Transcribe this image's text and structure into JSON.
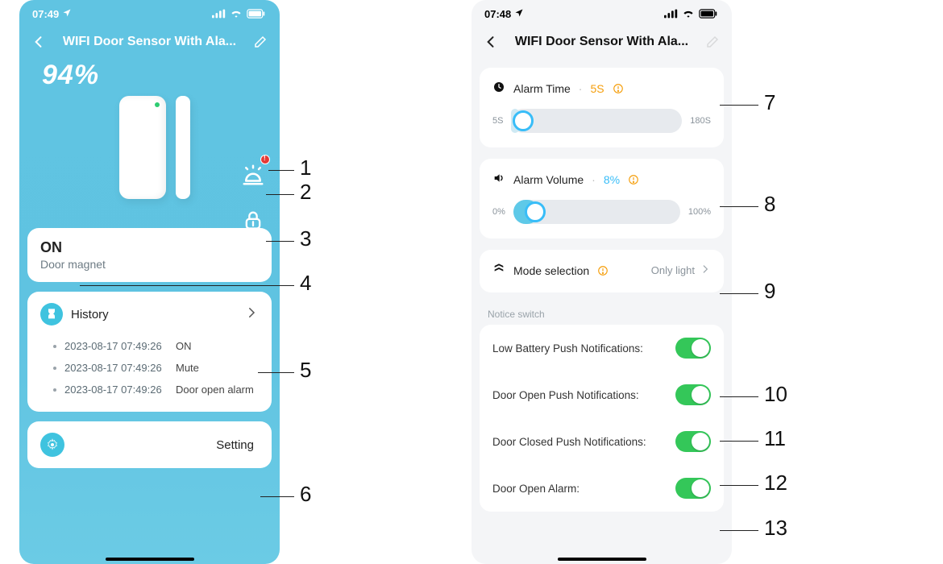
{
  "left": {
    "status": {
      "time": "07:49"
    },
    "nav": {
      "title": "WIFI Door Sensor With Ala..."
    },
    "battery": "94%",
    "magnet": {
      "state": "ON",
      "label": "Door magnet"
    },
    "history": {
      "title": "History",
      "rows": [
        {
          "ts": "2023-08-17 07:49:26",
          "ev": "ON"
        },
        {
          "ts": "2023-08-17 07:49:26",
          "ev": "Mute"
        },
        {
          "ts": "2023-08-17 07:49:26",
          "ev": "Door open alarm"
        }
      ]
    },
    "setting_label": "Setting"
  },
  "right": {
    "status": {
      "time": "07:48"
    },
    "nav": {
      "title": "WIFI Door Sensor With Ala..."
    },
    "alarm_time": {
      "label": "Alarm Time",
      "value": "5S",
      "min": "5S",
      "max": "180S"
    },
    "alarm_volume": {
      "label": "Alarm Volume",
      "value": "8%",
      "min": "0%",
      "max": "100%"
    },
    "mode": {
      "label": "Mode selection",
      "value": "Only light"
    },
    "notice_label": "Notice switch",
    "switches": [
      {
        "label": "Low Battery Push Notifications:"
      },
      {
        "label": "Door Open Push Notifications:"
      },
      {
        "label": "Door Closed Push Notifications:"
      },
      {
        "label": "Door Open Alarm:"
      }
    ]
  },
  "annotations": [
    "1",
    "2",
    "3",
    "4",
    "5",
    "6",
    "7",
    "8",
    "9",
    "10",
    "11",
    "12",
    "13"
  ]
}
